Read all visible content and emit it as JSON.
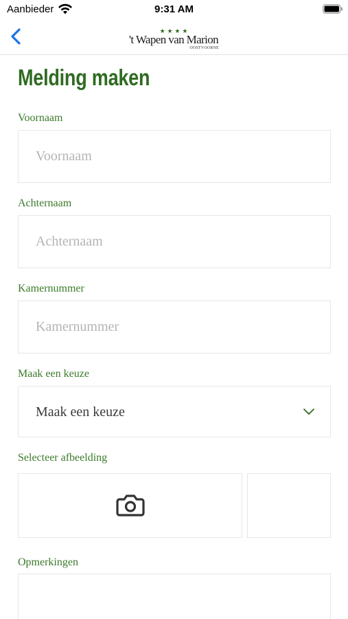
{
  "status_bar": {
    "carrier": "Aanbieder",
    "time": "9:31 AM"
  },
  "nav": {
    "back_icon": "chevron-left-icon",
    "logo": {
      "stars": "★ ★ ★ ★",
      "name": "'t Wapen van Marion",
      "location": "OOSTVOORNE"
    }
  },
  "page": {
    "title": "Melding maken"
  },
  "form": {
    "first_name": {
      "label": "Voornaam",
      "placeholder": "Voornaam",
      "value": ""
    },
    "last_name": {
      "label": "Achternaam",
      "placeholder": "Achternaam",
      "value": ""
    },
    "room_number": {
      "label": "Kamernummer",
      "placeholder": "Kamernummer",
      "value": ""
    },
    "choice": {
      "label": "Maak een keuze",
      "value": "Maak een keuze"
    },
    "image": {
      "label": "Selecteer afbeelding",
      "icon": "camera-icon"
    },
    "remarks": {
      "label": "Opmerkingen"
    }
  },
  "colors": {
    "accent_green": "#2f6b22",
    "label_green": "#3b7a2a",
    "ios_blue": "#1a73e8",
    "border": "#e6e6e6"
  }
}
